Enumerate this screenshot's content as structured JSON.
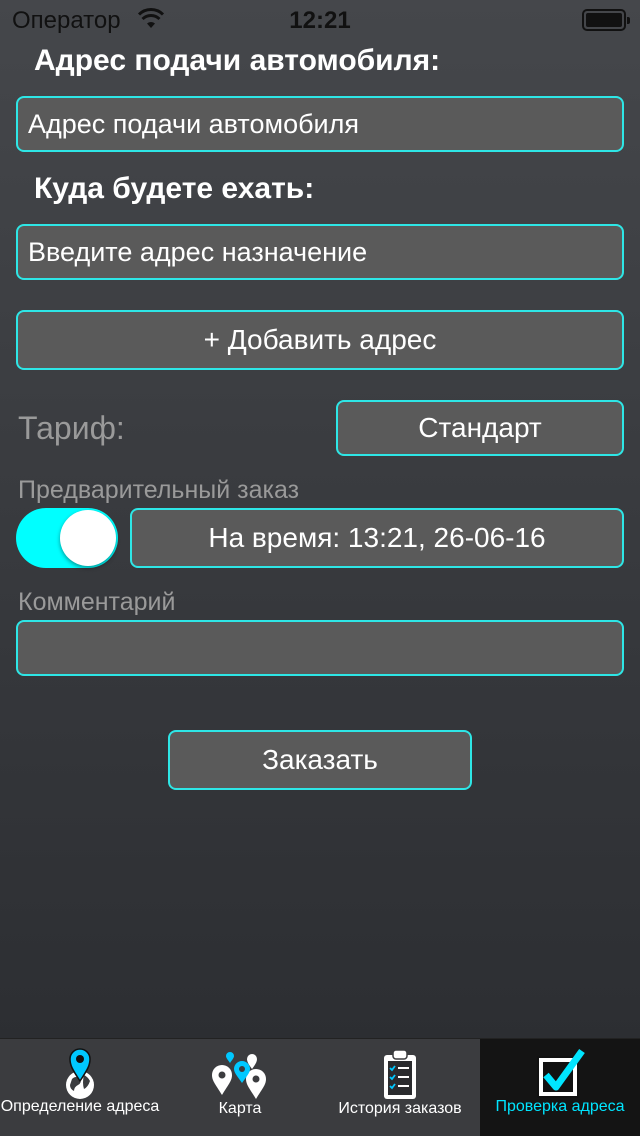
{
  "status_bar": {
    "carrier": "Оператор",
    "time": "12:21"
  },
  "pickup": {
    "heading": "Адрес подачи автомобиля:",
    "placeholder": "Адрес подачи автомобиля"
  },
  "destination": {
    "heading": "Куда будете ехать:",
    "placeholder": "Введите адрес назначение"
  },
  "add_address_label": "+ Добавить адрес",
  "tariff": {
    "label": "Тариф:",
    "value": "Стандарт"
  },
  "preorder": {
    "label": "Предварительный заказ",
    "toggle_on": true,
    "time_button": "На время: 13:21, 26-06-16"
  },
  "comment": {
    "label": "Комментарий",
    "value": ""
  },
  "order_button": "Заказать",
  "tabs": [
    {
      "label": "Определение адреса",
      "icon": "globe-pin-icon",
      "active": false
    },
    {
      "label": "Карта",
      "icon": "map-pins-icon",
      "active": false
    },
    {
      "label": "История заказов",
      "icon": "clipboard-list-icon",
      "active": false
    },
    {
      "label": "Проверка адреса",
      "icon": "checkbox-icon",
      "active": true
    }
  ],
  "colors": {
    "accent": "#2ee6e6",
    "toggle": "#00ffff",
    "active_tab_text": "#00e5ff"
  }
}
